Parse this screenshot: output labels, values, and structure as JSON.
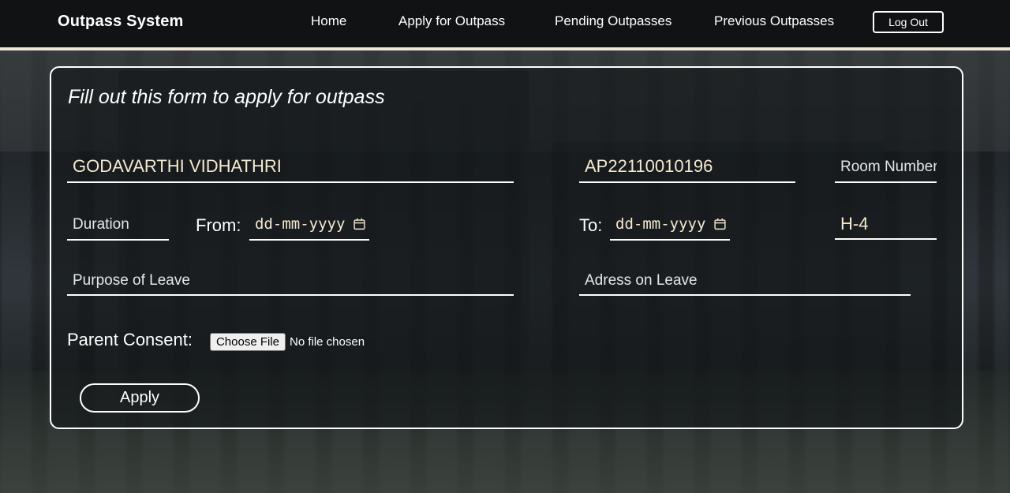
{
  "navbar": {
    "brand": "Outpass System",
    "links": [
      "Home",
      "Apply for Outpass",
      "Pending Outpasses",
      "Previous Outpasses"
    ],
    "logout_label": "Log Out"
  },
  "form": {
    "title": "Fill out this form to apply for outpass",
    "name_value": "GODAVARTHI VIDHATHRI",
    "id_value": "AP22110010196",
    "room_placeholder": "Room Number",
    "duration_placeholder": "Duration",
    "from_label": "From:",
    "from_placeholder": "dd-mm-yyyy",
    "to_label": "To:",
    "to_placeholder": "dd-mm-yyyy",
    "hostel_value": "H-4",
    "purpose_placeholder": "Purpose of Leave",
    "address_placeholder": "Adress on Leave",
    "consent_label": "Parent Consent:",
    "file_button_label": "Choose File",
    "file_status": "No file chosen",
    "apply_label": "Apply"
  },
  "icons": {
    "calendar": "calendar-icon"
  },
  "colors": {
    "navbar_bg": "#111213",
    "navbar_border": "#efe6d4",
    "input_text": "#f5e9d0"
  }
}
